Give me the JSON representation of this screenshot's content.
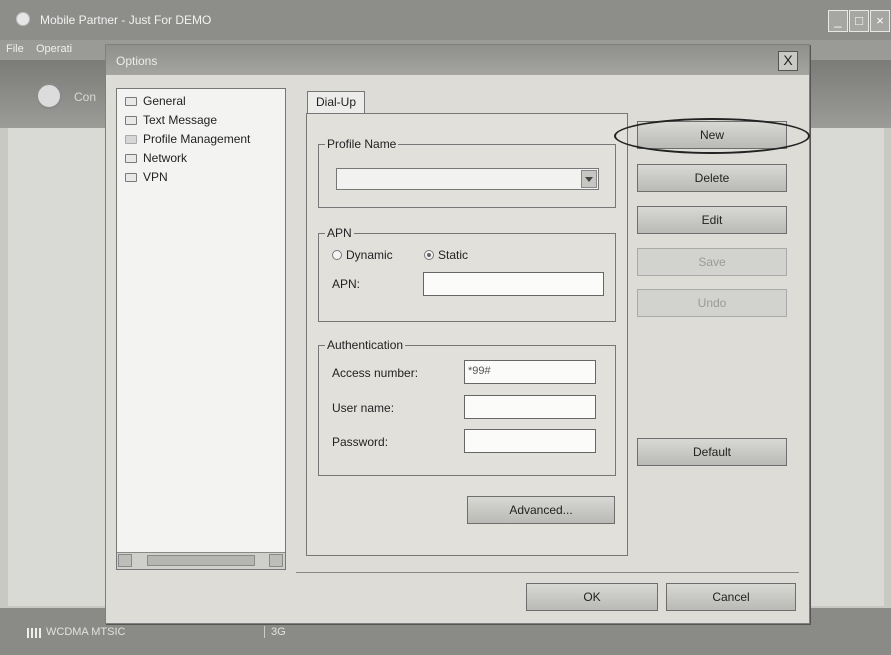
{
  "app": {
    "title": "Mobile Partner - Just For DEMO",
    "menu": [
      "File",
      "Operati"
    ],
    "toolbar_label": "Con",
    "status_carrier": "WCDMA MTSIC",
    "status_mode": "3G"
  },
  "dialog": {
    "title": "Options",
    "close_label": "X",
    "tree": [
      "General",
      "Text Message",
      "Profile Management",
      "Network",
      "VPN"
    ],
    "tab": "Dial-Up",
    "profile_group": "Profile Name",
    "apn_group": "APN",
    "apn_dynamic": "Dynamic",
    "apn_static": "Static",
    "apn_label": "APN:",
    "auth_group": "Authentication",
    "access_number_label": "Access number:",
    "access_number_value": "*99#",
    "user_name_label": "User name:",
    "password_label": "Password:",
    "advanced_label": "Advanced...",
    "buttons": {
      "new": "New",
      "delete": "Delete",
      "edit": "Edit",
      "save": "Save",
      "undo": "Undo",
      "default": "Default"
    },
    "ok_label": "OK",
    "cancel_label": "Cancel"
  }
}
